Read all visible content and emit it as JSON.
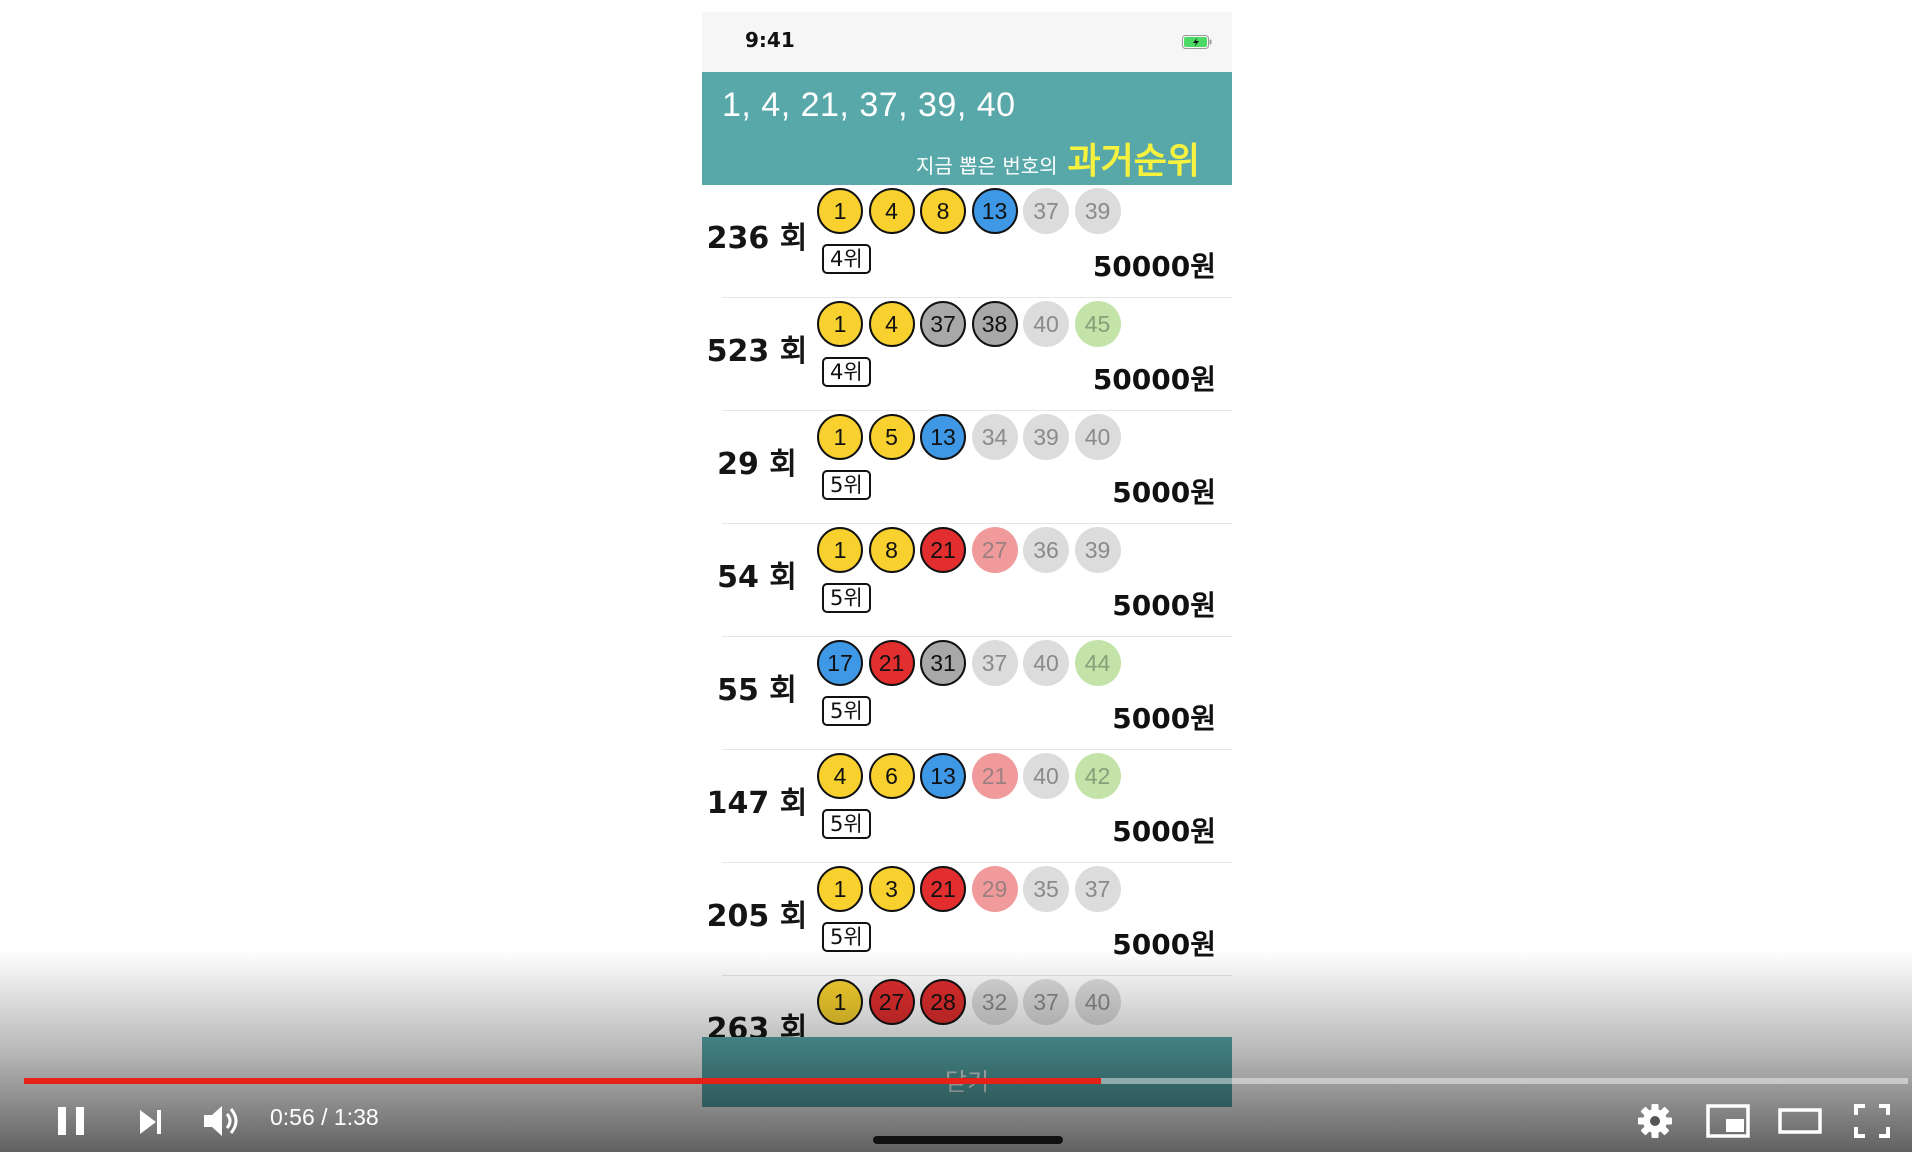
{
  "status_bar": {
    "time": "9:41"
  },
  "header": {
    "picked_numbers": "1, 4, 21, 37, 39, 40",
    "subtitle_small": "지금 뽑은 번호의",
    "subtitle_big": "과거순위"
  },
  "results": [
    {
      "round": "236 회",
      "rank": "4위",
      "prize": "50000원",
      "balls": [
        [
          "1",
          "yellow"
        ],
        [
          "4",
          "yellow"
        ],
        [
          "8",
          "yellow"
        ],
        [
          "13",
          "blue"
        ],
        [
          "37",
          "f-gray"
        ],
        [
          "39",
          "f-gray"
        ]
      ]
    },
    {
      "round": "523 회",
      "rank": "4위",
      "prize": "50000원",
      "balls": [
        [
          "1",
          "yellow"
        ],
        [
          "4",
          "yellow"
        ],
        [
          "37",
          "gray"
        ],
        [
          "38",
          "gray"
        ],
        [
          "40",
          "f-gray"
        ],
        [
          "45",
          "f-green"
        ]
      ]
    },
    {
      "round": "29 회",
      "rank": "5위",
      "prize": "5000원",
      "balls": [
        [
          "1",
          "yellow"
        ],
        [
          "5",
          "yellow"
        ],
        [
          "13",
          "blue"
        ],
        [
          "34",
          "f-gray"
        ],
        [
          "39",
          "f-gray"
        ],
        [
          "40",
          "f-gray"
        ]
      ]
    },
    {
      "round": "54 회",
      "rank": "5위",
      "prize": "5000원",
      "balls": [
        [
          "1",
          "yellow"
        ],
        [
          "8",
          "yellow"
        ],
        [
          "21",
          "red"
        ],
        [
          "27",
          "f-red"
        ],
        [
          "36",
          "f-gray"
        ],
        [
          "39",
          "f-gray"
        ]
      ]
    },
    {
      "round": "55 회",
      "rank": "5위",
      "prize": "5000원",
      "balls": [
        [
          "17",
          "blue"
        ],
        [
          "21",
          "red"
        ],
        [
          "31",
          "gray"
        ],
        [
          "37",
          "f-gray"
        ],
        [
          "40",
          "f-gray"
        ],
        [
          "44",
          "f-green"
        ]
      ]
    },
    {
      "round": "147 회",
      "rank": "5위",
      "prize": "5000원",
      "balls": [
        [
          "4",
          "yellow"
        ],
        [
          "6",
          "yellow"
        ],
        [
          "13",
          "blue"
        ],
        [
          "21",
          "f-red"
        ],
        [
          "40",
          "f-gray"
        ],
        [
          "42",
          "f-green"
        ]
      ]
    },
    {
      "round": "205 회",
      "rank": "5위",
      "prize": "5000원",
      "balls": [
        [
          "1",
          "yellow"
        ],
        [
          "3",
          "yellow"
        ],
        [
          "21",
          "red"
        ],
        [
          "29",
          "f-red"
        ],
        [
          "35",
          "f-gray"
        ],
        [
          "37",
          "f-gray"
        ]
      ]
    },
    {
      "round": "263 회",
      "rank": "",
      "prize": "",
      "balls": [
        [
          "1",
          "yellow"
        ],
        [
          "27",
          "red"
        ],
        [
          "28",
          "red"
        ],
        [
          "32",
          "f-gray"
        ],
        [
          "37",
          "f-gray"
        ],
        [
          "40",
          "f-gray"
        ]
      ]
    }
  ],
  "close_button": "닫기",
  "player": {
    "current_time": "0:56",
    "duration": "1:38",
    "timecode": "0:56 / 1:38",
    "progress_fraction": 0.5714,
    "accent_color": "#e62117"
  }
}
